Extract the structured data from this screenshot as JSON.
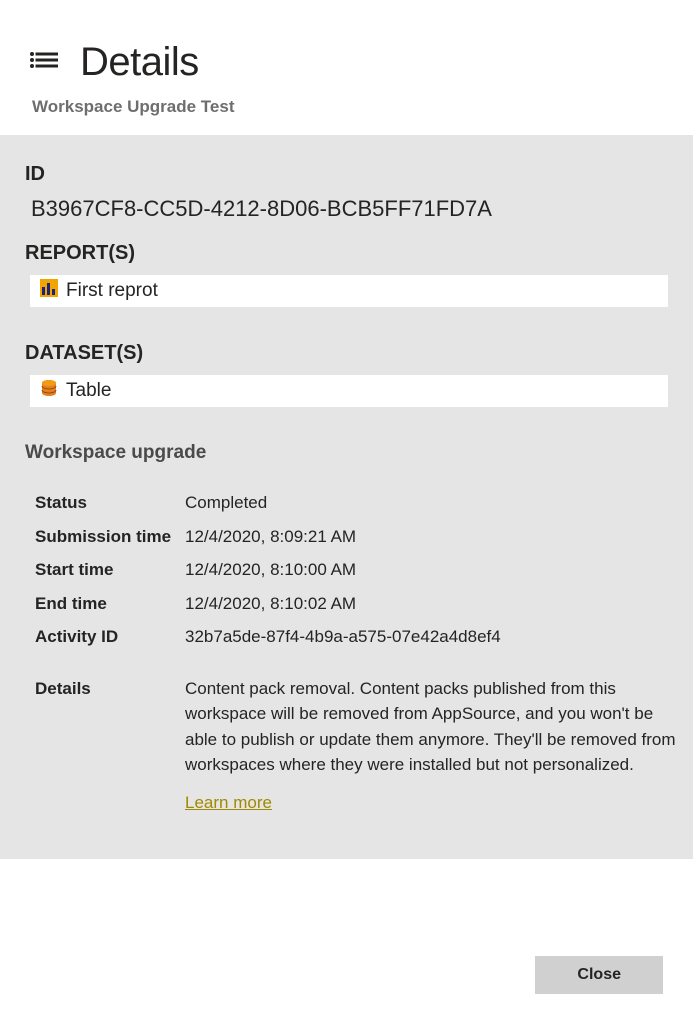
{
  "header": {
    "title": "Details",
    "subtitle": "Workspace Upgrade Test"
  },
  "id": {
    "label": "ID",
    "value": "B3967CF8-CC5D-4212-8D06-BCB5FF71FD7A"
  },
  "reports": {
    "label": "REPORT(S)",
    "items": [
      {
        "name": "First reprot"
      }
    ]
  },
  "datasets": {
    "label": "DATASET(S)",
    "items": [
      {
        "name": "Table"
      }
    ]
  },
  "upgrade": {
    "heading": "Workspace upgrade",
    "rows": {
      "status": {
        "label": "Status",
        "value": "Completed"
      },
      "submission": {
        "label": "Submission time",
        "value": "12/4/2020, 8:09:21 AM"
      },
      "start": {
        "label": "Start time",
        "value": "12/4/2020, 8:10:00 AM"
      },
      "end": {
        "label": "End time",
        "value": "12/4/2020, 8:10:02 AM"
      },
      "activity": {
        "label": "Activity ID",
        "value": "32b7a5de-87f4-4b9a-a575-07e42a4d8ef4"
      },
      "details": {
        "label": "Details",
        "value": "Content pack removal. Content packs published from this workspace will be removed from AppSource, and you won't be able to publish or update them anymore. They'll be removed from workspaces where they were installed but not personalized."
      }
    },
    "learn_more": "Learn more"
  },
  "footer": {
    "close": "Close"
  }
}
